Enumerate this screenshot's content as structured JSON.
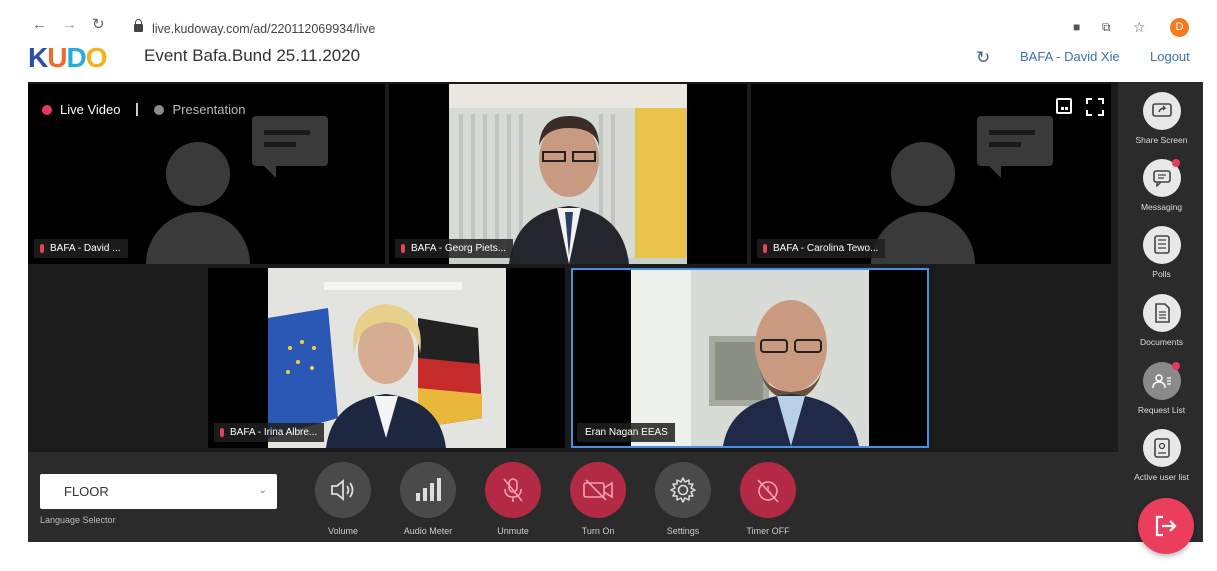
{
  "browser": {
    "url": "live.kudoway.com/ad/220112069934/live",
    "profile_initial": "D"
  },
  "header": {
    "logo_letters": [
      "K",
      "U",
      "D",
      "O"
    ],
    "logo_colors": [
      "#2b4fa5",
      "#f0682b",
      "#27a9e1",
      "#f6b21a"
    ],
    "event_title": "Event Bafa.Bund 25.11.2020",
    "user": "BAFA - David Xie",
    "logout": "Logout"
  },
  "stage": {
    "live_video_label": "Live Video",
    "presentation_label": "Presentation",
    "live_color": "#e83a5a",
    "presentation_color": "#8a8a8a",
    "tiles": [
      {
        "name": "BAFA - David ...",
        "video": false
      },
      {
        "name": "BAFA - Georg Piets...",
        "video": true
      },
      {
        "name": "BAFA - Carolina Tewo...",
        "video": false
      },
      {
        "name": "BAFA - Irina Albre...",
        "video": true
      },
      {
        "name": "Eran Nagan EEAS",
        "video": true,
        "active": true
      }
    ]
  },
  "sidebar": {
    "items": [
      {
        "label": "Share Screen",
        "icon": "share-screen-icon",
        "badge": false
      },
      {
        "label": "Messaging",
        "icon": "chat-icon",
        "badge": true
      },
      {
        "label": "Polls",
        "icon": "polls-icon",
        "badge": false
      },
      {
        "label": "Documents",
        "icon": "document-icon",
        "badge": false
      },
      {
        "label": "Request List",
        "icon": "request-list-icon",
        "badge": true
      },
      {
        "label": "Active user list",
        "icon": "user-list-icon",
        "badge": false
      }
    ]
  },
  "controls": {
    "language_value": "FLOOR",
    "language_label": "Language Selector",
    "buttons": [
      {
        "label": "Volume",
        "icon": "speaker-icon",
        "state": "gray"
      },
      {
        "label": "Audio Meter",
        "icon": "signal-bars-icon",
        "state": "gray"
      },
      {
        "label": "Unmute",
        "icon": "mic-off-icon",
        "state": "red"
      },
      {
        "label": "Turn On",
        "icon": "camera-off-icon",
        "state": "red"
      },
      {
        "label": "Settings",
        "icon": "gear-icon",
        "state": "gray"
      },
      {
        "label": "Timer OFF",
        "icon": "timer-off-icon",
        "state": "red"
      }
    ]
  }
}
